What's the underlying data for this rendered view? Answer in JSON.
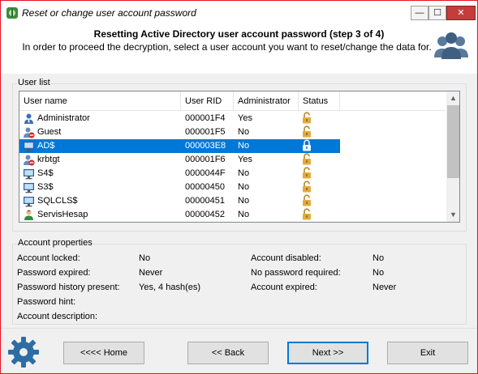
{
  "window": {
    "title": "Reset or change user account password",
    "controls": {
      "minimize": "—",
      "maximize": "☐",
      "close": "✕"
    }
  },
  "header": {
    "title": "Resetting Active Directory user account password (step 3 of 4)",
    "subtitle": "In order to proceed the decryption, select a user account you want to reset/change the data for.",
    "icon": "users-group-icon"
  },
  "user_list": {
    "group_label": "User list",
    "columns": [
      "User name",
      "User RID",
      "Administrator",
      "Status"
    ],
    "rows": [
      {
        "name": "Administrator",
        "rid": "000001F4",
        "admin": "Yes",
        "icon": "user-admin-icon",
        "lock": "unlocked",
        "selected": false
      },
      {
        "name": "Guest",
        "rid": "000001F5",
        "admin": "No",
        "icon": "user-disabled-icon",
        "lock": "unlocked",
        "selected": false
      },
      {
        "name": "AD$",
        "rid": "000003E8",
        "admin": "No",
        "icon": "computer-icon",
        "lock": "locked",
        "selected": true
      },
      {
        "name": "krbtgt",
        "rid": "000001F6",
        "admin": "Yes",
        "icon": "user-disabled-icon",
        "lock": "unlocked",
        "selected": false
      },
      {
        "name": "S4$",
        "rid": "0000044F",
        "admin": "No",
        "icon": "computer-icon",
        "lock": "unlocked",
        "selected": false
      },
      {
        "name": "S3$",
        "rid": "00000450",
        "admin": "No",
        "icon": "computer-icon",
        "lock": "unlocked",
        "selected": false
      },
      {
        "name": "SQLCLS$",
        "rid": "00000451",
        "admin": "No",
        "icon": "computer-icon",
        "lock": "unlocked",
        "selected": false
      },
      {
        "name": "ServisHesap",
        "rid": "00000452",
        "admin": "No",
        "icon": "user-green-icon",
        "lock": "unlocked",
        "selected": false
      }
    ]
  },
  "account_properties": {
    "group_label": "Account properties",
    "account_locked": {
      "label": "Account locked:",
      "value": "No"
    },
    "password_expired": {
      "label": "Password expired:",
      "value": "Never"
    },
    "password_history": {
      "label": "Password history present:",
      "value": "Yes, 4 hash(es)"
    },
    "password_hint": {
      "label": "Password hint:",
      "value": ""
    },
    "account_description": {
      "label": "Account description:",
      "value": ""
    },
    "account_disabled": {
      "label": "Account disabled:",
      "value": "No"
    },
    "no_password_required": {
      "label": "No password required:",
      "value": "No"
    },
    "account_expired": {
      "label": "Account expired:",
      "value": "Never"
    }
  },
  "footer": {
    "home": "<<<< Home",
    "back": "<< Back",
    "next": "Next >>",
    "exit": "Exit"
  },
  "colors": {
    "selection": "#0078d7",
    "lock_gold": "#d9a13a",
    "close_red": "#c43c3c"
  }
}
